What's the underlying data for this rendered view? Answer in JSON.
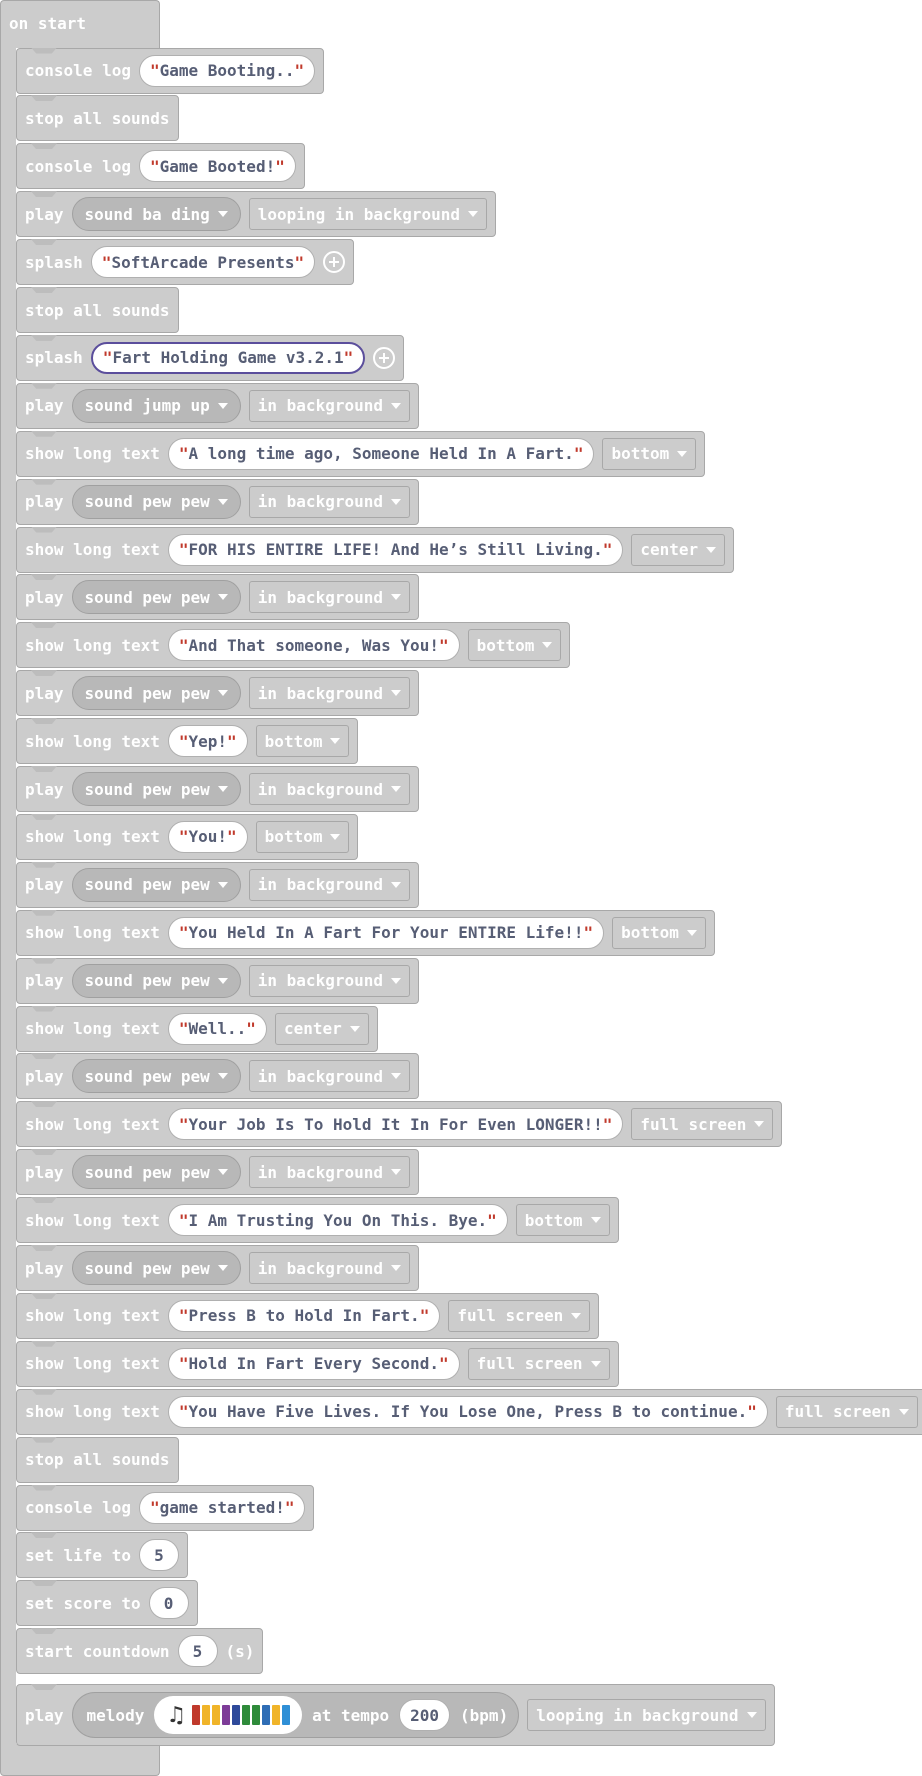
{
  "hat_label": "on start",
  "colors": {
    "block": "#cccccc",
    "pill": "#b8b8b8",
    "string_text": "#575e75",
    "quote": "#c0392b",
    "selected_outline": "#5b4e9c"
  },
  "blocks": [
    {
      "type": "log",
      "kw": "console log",
      "text": "Game Booting.."
    },
    {
      "type": "stop",
      "kw": "stop all sounds"
    },
    {
      "type": "log",
      "kw": "console log",
      "text": "Game Booted!"
    },
    {
      "type": "play",
      "kw": "play",
      "sound": "sound ba ding",
      "mode": "looping in background"
    },
    {
      "type": "splash",
      "kw": "splash",
      "text": "SoftArcade Presents",
      "selected": false
    },
    {
      "type": "stop",
      "kw": "stop all sounds"
    },
    {
      "type": "splash",
      "kw": "splash",
      "text": "Fart Holding Game v3.2.1",
      "selected": true
    },
    {
      "type": "play",
      "kw": "play",
      "sound": "sound jump up",
      "mode": "in background"
    },
    {
      "type": "text",
      "kw": "show long text",
      "text": "A long time ago, Someone Held In A Fart.",
      "pos": "bottom"
    },
    {
      "type": "play",
      "kw": "play",
      "sound": "sound pew pew",
      "mode": "in background"
    },
    {
      "type": "text",
      "kw": "show long text",
      "text": "FOR HIS ENTIRE LIFE! And He’s Still Living.",
      "pos": "center"
    },
    {
      "type": "play",
      "kw": "play",
      "sound": "sound pew pew",
      "mode": "in background"
    },
    {
      "type": "text",
      "kw": "show long text",
      "text": "And That someone, Was You!",
      "pos": "bottom"
    },
    {
      "type": "play",
      "kw": "play",
      "sound": "sound pew pew",
      "mode": "in background"
    },
    {
      "type": "text",
      "kw": "show long text",
      "text": "Yep!",
      "pos": "bottom"
    },
    {
      "type": "play",
      "kw": "play",
      "sound": "sound pew pew",
      "mode": "in background"
    },
    {
      "type": "text",
      "kw": "show long text",
      "text": "You!",
      "pos": "bottom"
    },
    {
      "type": "play",
      "kw": "play",
      "sound": "sound pew pew",
      "mode": "in background"
    },
    {
      "type": "text",
      "kw": "show long text",
      "text": "You Held In A Fart For Your ENTIRE Life!!",
      "pos": "bottom"
    },
    {
      "type": "play",
      "kw": "play",
      "sound": "sound pew pew",
      "mode": "in background"
    },
    {
      "type": "text",
      "kw": "show long text",
      "text": "Well..",
      "pos": "center"
    },
    {
      "type": "play",
      "kw": "play",
      "sound": "sound pew pew",
      "mode": "in background"
    },
    {
      "type": "text",
      "kw": "show long text",
      "text": "Your Job Is To Hold It In For Even LONGER!!",
      "pos": "full screen"
    },
    {
      "type": "play",
      "kw": "play",
      "sound": "sound pew pew",
      "mode": "in background"
    },
    {
      "type": "text",
      "kw": "show long text",
      "text": "I Am Trusting You On This. Bye.",
      "pos": "bottom"
    },
    {
      "type": "play",
      "kw": "play",
      "sound": "sound pew pew",
      "mode": "in background"
    },
    {
      "type": "text",
      "kw": "show long text",
      "text": "Press B to Hold In Fart.",
      "pos": "full screen"
    },
    {
      "type": "text",
      "kw": "show long text",
      "text": "Hold In Fart Every Second.",
      "pos": "full screen"
    },
    {
      "type": "text",
      "kw": "show long text",
      "text": "You Have Five Lives. If You Lose One, Press B to continue.",
      "pos": "full screen"
    },
    {
      "type": "stop",
      "kw": "stop all sounds"
    },
    {
      "type": "log",
      "kw": "console log",
      "text": "game started!"
    },
    {
      "type": "setnum",
      "kw": "set life to",
      "value": "5"
    },
    {
      "type": "setnum",
      "kw": "set score to",
      "value": "0"
    },
    {
      "type": "countdown",
      "kw": "start countdown",
      "value": "5",
      "unit": "(s)"
    },
    {
      "type": "melody",
      "kw": "play",
      "melody_label": "melody",
      "tempo_label": "at tempo",
      "tempo": "200",
      "tempo_unit": "(bpm)",
      "mode": "looping in background",
      "notes": [
        "#c0392b",
        "#f0b429",
        "#f0b429",
        "#7d3c98",
        "#2e4a9a",
        "#2e8b3a",
        "#2e8b3a",
        "#2f6db5",
        "#f0b429",
        "#2f8fd6"
      ]
    }
  ]
}
